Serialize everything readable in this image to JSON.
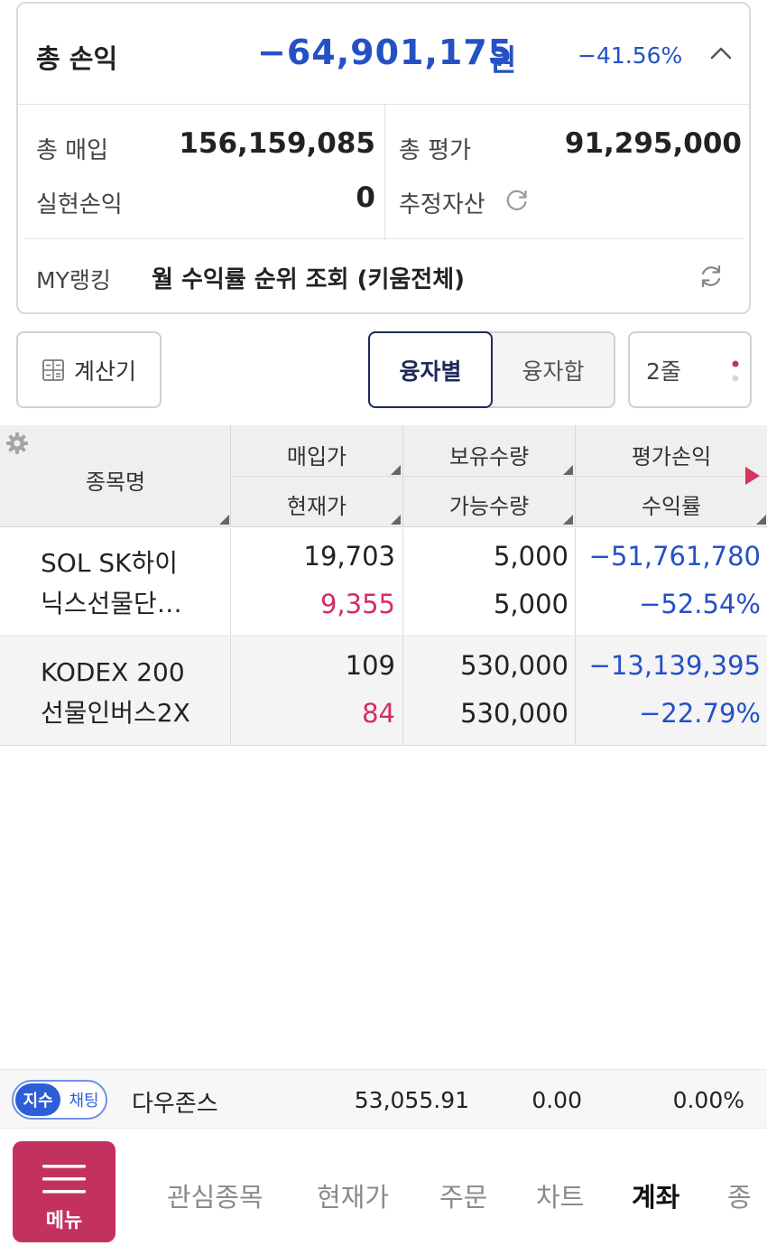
{
  "summary": {
    "total_pl_label": "총 손익",
    "total_pl_amount": "−64,901,175",
    "total_pl_unit": "원",
    "total_pl_rate": "−41.56%",
    "total_purchase_label": "총 매입",
    "total_purchase_value": "156,159,085",
    "total_eval_label": "총 평가",
    "total_eval_value": "91,295,000",
    "realized_label": "실현손익",
    "realized_value": "0",
    "estimated_assets_label": "추정자산",
    "ranking_label": "MY랭킹",
    "ranking_text": "월 수익률 순위 조회 (키움전체)"
  },
  "toolbar": {
    "calculator_label": "계산기",
    "seg_active_label": "융자별",
    "seg_inactive_label": "융자합",
    "rows_label": "2줄"
  },
  "table": {
    "headers": {
      "name": "종목명",
      "buy_price": "매입가",
      "current_price": "현재가",
      "holding_qty": "보유수량",
      "available_qty": "가능수량",
      "eval_pl": "평가손익",
      "return_rate": "수익률"
    },
    "rows": [
      {
        "name_line1": "SOL SK하이",
        "name_line2": "닉스선물단…",
        "buy_price": "19,703",
        "current_price": "9,355",
        "holding_qty": "5,000",
        "available_qty": "5,000",
        "eval_pl": "−51,761,780",
        "return_rate": "−52.54%"
      },
      {
        "name_line1": "KODEX 200",
        "name_line2": "선물인버스2X",
        "buy_price": "109",
        "current_price": "84",
        "holding_qty": "530,000",
        "available_qty": "530,000",
        "eval_pl": "−13,139,395",
        "return_rate": "−22.79%"
      }
    ]
  },
  "ticker": {
    "toggle_on": "지수",
    "toggle_off": "채팅",
    "name": "다우존스",
    "value": "53,055.91",
    "change": "0.00",
    "change_rate": "0.00%"
  },
  "nav": {
    "menu_label": "메뉴",
    "items": [
      "관심종목",
      "현재가",
      "주문",
      "차트",
      "계좌",
      "종"
    ]
  },
  "colors": {
    "negative_blue": "#2551c4",
    "price_red": "#d22d63",
    "menu_brand": "#c3325f",
    "active_segment": "#1e2a5a"
  }
}
